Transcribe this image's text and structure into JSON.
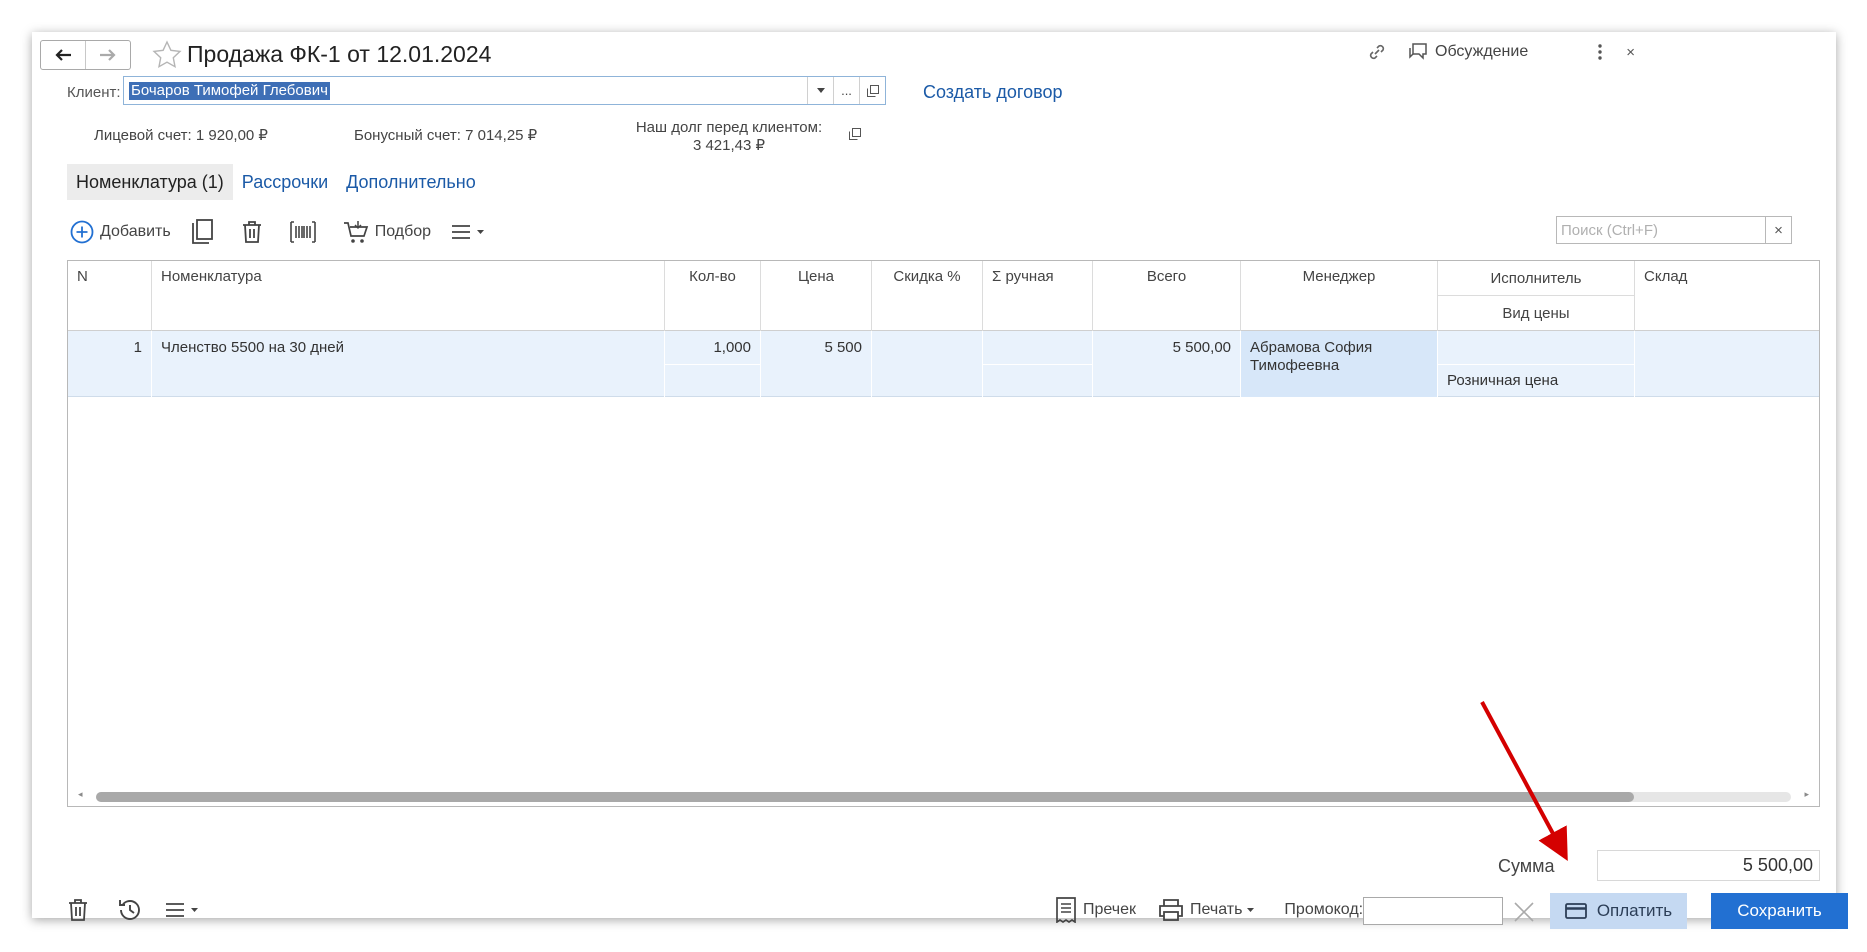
{
  "window": {
    "title": "Продажа ФК-1 от 12.01.2024",
    "link_icon": "link-icon",
    "discussion_label": "Обсуждение",
    "more_icon": "more-vertical-icon"
  },
  "client": {
    "label": "Клиент:",
    "value": "Бочаров Тимофей Глебович",
    "create_contract_link": "Создать договор"
  },
  "accounts": {
    "personal": "Лицевой счет: 1 920,00 ₽",
    "bonus": "Бонусный счет: 7 014,25 ₽",
    "debt_label": "Наш долг перед клиентом:",
    "debt_value": "3 421,43 ₽"
  },
  "tabs": [
    {
      "label": "Номенклатура (1)",
      "active": true
    },
    {
      "label": "Рассрочки",
      "active": false
    },
    {
      "label": "Дополнительно",
      "active": false
    }
  ],
  "toolbar": {
    "add_label": "Добавить",
    "selection_label": "Подбор",
    "search_placeholder": "Поиск (Ctrl+F)",
    "search_clear": "×"
  },
  "table": {
    "columns": {
      "n": "N",
      "item": "Номенклатура",
      "qty": "Кол-во",
      "price": "Цена",
      "discount": "Скидка %",
      "manual_sum": "Σ ручная",
      "total": "Всего",
      "manager": "Менеджер",
      "executor": "Исполнитель",
      "price_type": "Вид цены",
      "warehouse": "Склад"
    },
    "rows": [
      {
        "n": "1",
        "item": "Членство 5500 на 30 дней",
        "qty": "1,000",
        "price": "5 500",
        "discount": "",
        "manual_sum": "",
        "total": "5 500,00",
        "manager": "Абрамова София Тимофеевна",
        "executor": "",
        "price_type": "Розничная цена",
        "warehouse": ""
      }
    ]
  },
  "summary": {
    "sum_label": "Сумма",
    "sum_value": "5 500,00"
  },
  "footer": {
    "receipt_label": "Пречек",
    "print_label": "Печать",
    "promo_label": "Промокод:",
    "promo_value": "",
    "pay_label": "Оплатить",
    "save_label": "Сохранить"
  },
  "colors": {
    "accent": "#2270d2",
    "link": "#1b5aa7",
    "pay_button": "#c5d9f2",
    "selected_row": "#e9f2fc",
    "annotation_arrow": "#d40000"
  }
}
